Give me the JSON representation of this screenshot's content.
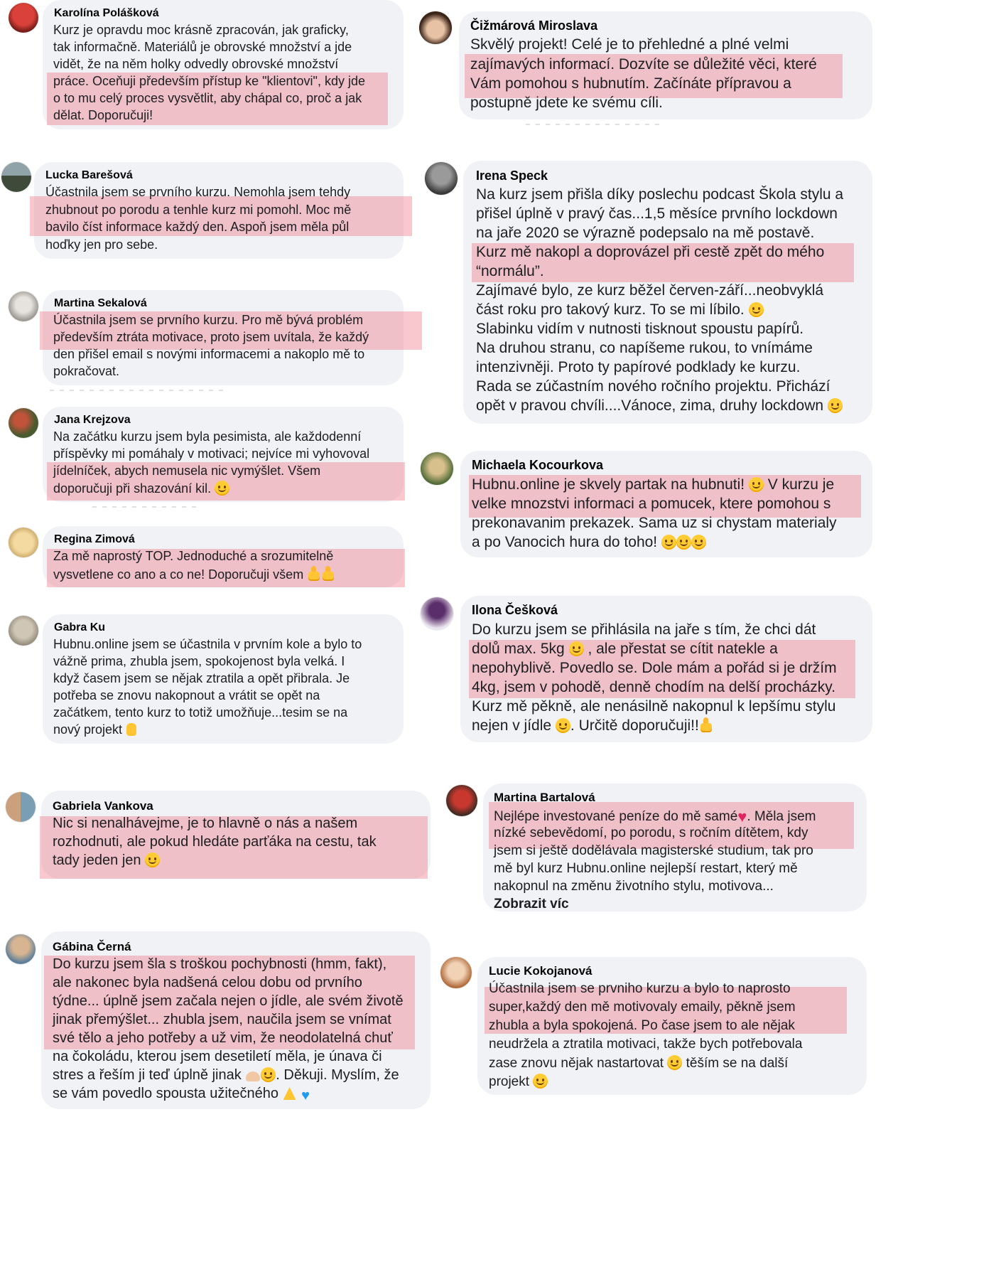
{
  "comments": [
    {
      "id": "karolina",
      "name": "Karolína Polášková",
      "lines": [
        "Kurz je opravdu moc krásně zpracován, jak graficky,",
        "tak informačně. Materiálů je obrovské množství a jde",
        "vidět, že na něm holky odvedly obrovské množství",
        "práce. Oceňuji především přístup ke \"klientovi\", kdy jde",
        "o to mu celý proces vysvětlit, aby chápal co, proč a jak",
        "dělat. Doporučuji!"
      ]
    },
    {
      "id": "cizmarova",
      "name": "Čižmárová Miroslava",
      "lines": [
        "Skvělý projekt! Celé je to přehledné a plné velmi",
        "zajímavých informací. Dozvíte se důležité věci, které",
        "Vám pomohou s hubnutím. Začínáte přípravou a",
        "postupně jdete ke svému cíli."
      ]
    },
    {
      "id": "lucka",
      "name": "Lucka Barešová",
      "lines": [
        "Účastnila jsem se prvního kurzu. Nemohla jsem tehdy",
        "zhubnout po porodu a tenhle kurz mi pomohl. Moc mě",
        "bavilo číst informace každý den. Aspoň jsem měla půl",
        "hoďky jen pro sebe."
      ]
    },
    {
      "id": "irena",
      "name": "Irena Speck",
      "lines": [
        "Na kurz jsem přišla díky poslechu podcast Škola stylu a",
        "přišel úplně v pravý čas...1,5 měsíce prvního lockdown",
        "na jaře 2020 se výrazně podepsalo na mě postavě.",
        "Kurz mě nakopl a doprovázel při cestě zpět do mého",
        "“normálu”.",
        "Zajímavé bylo, ze kurz běžel červen-září...neobvyklá",
        "část roku pro takový kurz. To se mi líbilo.",
        "Slabinku vidím v nutnosti tisknout spoustu papírů.",
        "Na druhou stranu, co napíšeme rukou, to vnímáme",
        "intenzivněji. Proto ty papírové podklady ke kurzu.",
        "Rada se zúčastním nového ročního projektu. Přichází",
        "opět v pravou chvíli....Vánoce, zima, druhy lockdown"
      ]
    },
    {
      "id": "martina-s",
      "name": "Martina Sekalová",
      "lines": [
        "Účastnila jsem se prvního kurzu. Pro mě bývá problém",
        "především ztráta motivace, proto jsem uvítala, že každý",
        "den přišel email s novými informacemi a nakoplo mě to",
        "pokračovat."
      ]
    },
    {
      "id": "jana",
      "name": "Jana Krejzova",
      "lines": [
        "Na začátku kurzu jsem byla pesimista, ale každodenní",
        "příspěvky mi pomáhaly v motivaci; nejvíce mi vyhovoval",
        "jídelníček, abych nemusela nic vymýšlet. Všem",
        "doporučuji při shazování kil."
      ]
    },
    {
      "id": "michaela",
      "name": "Michaela Kocourkova",
      "lines": [
        "Hubnu.online je skvely partak na hubnuti!",
        "V kurzu je",
        "velke mnozstvi informaci a pomucek, ktere pomohou s",
        "prekonavanim prekazek. Sama uz si chystam materialy",
        "a po Vanocich hura do toho!"
      ]
    },
    {
      "id": "regina",
      "name": "Regina Zimová",
      "lines": [
        "Za mě naprostý TOP. Jednoduché a srozumitelně",
        "vysvetlene co ano a co ne! Doporučuji všem"
      ]
    },
    {
      "id": "ilona",
      "name": "Ilona Češková",
      "lines": [
        "Do kurzu jsem se přihlásila na jaře s tím, že chci dát",
        "dolů max. 5kg",
        ", ale přestat se cítit natekle a",
        "nepohyblivě. Povedlo se. Dole mám a pořád si je držím",
        "4kg, jsem v pohodě, denně chodím na delší procházky.",
        "Kurz mě pěkně, ale nenásilně nakopnul k lepšímu stylu",
        "nejen v jídle",
        ". Určitě doporučuji!!"
      ]
    },
    {
      "id": "gabra",
      "name": "Gabra Ku",
      "lines": [
        "Hubnu.online jsem se účastnila v prvním kole a bylo to",
        "vážně prima, zhubla jsem, spokojenost byla velká. I",
        "když časem jsem se nějak ztratila a opět přibrala. Je",
        "potřeba se znovu nakopnout a vrátit se opět na",
        "začátkem, tento kurz to totiž umožňuje...tesim se na",
        "nový projekt"
      ]
    },
    {
      "id": "gabriela",
      "name": "Gabriela Vankova",
      "lines": [
        "Nic si nenalhávejme, je to hlavně o nás a našem",
        "rozhodnuti, ale pokud hledáte parťáka na cestu, tak",
        "tady jeden jen"
      ]
    },
    {
      "id": "martina-b",
      "name": "Martina Bartalová",
      "lines": [
        "Nejlépe investované peníze do mě samé",
        ". Měla jsem",
        "nízké sebevědomí, po porodu, s ročním dítětem, kdy",
        "jsem si ještě dodělávala magisterské studium, tak pro",
        "mě byl kurz Hubnu.online nejlepší restart, který mě",
        "nakopnul na změnu životního stylu, motivova..."
      ],
      "more": "Zobrazit víc"
    },
    {
      "id": "gabina",
      "name": "Gábina Černá",
      "lines": [
        "Do kurzu jsem šla s troškou pochybnosti (hmm, fakt),",
        "ale nakonec byla nadšená celou dobu od prvního",
        "týdne... úplně jsem začala nejen o jídle, ale svém životě",
        "jinak přemýšlet... zhubla jsem, naučila jsem se vnímat",
        "své tělo a jeho potřeby a už vim, že neodolatelná chuť",
        "na čokoládu, kterou jsem desetiletí měla, je únava či",
        "stres a řeším ji teď úplně jinak",
        ". Děkuji. Myslím, že",
        "se vám povedlo spousta užitečného"
      ]
    },
    {
      "id": "lucie",
      "name": "Lucie Kokojanová",
      "lines": [
        "Účastnila jsem se prvniho kurzu a bylo to naprosto",
        "super,každý den mě motivovaly emaily, pěkně jsem",
        "zhubla a byla spokojená. Po čase jsem to ale nějak",
        "neudržela a ztratila motivaci, takže bych potřebovala",
        "zase znovu nějak nastartovat",
        "těším se na další",
        "projekt"
      ]
    }
  ],
  "colors": {
    "bubble": "#f0f2f5",
    "highlight": "#f2a3b0",
    "text": "#1c1e21"
  },
  "icons": [
    "smile-emoji-icon",
    "grin-emoji-icon",
    "thumbs-up-icon",
    "heart-icon",
    "hug-emoji-icon",
    "pray-icon",
    "blue-heart-icon",
    "muscle-icon",
    "raised-hand-icon"
  ]
}
